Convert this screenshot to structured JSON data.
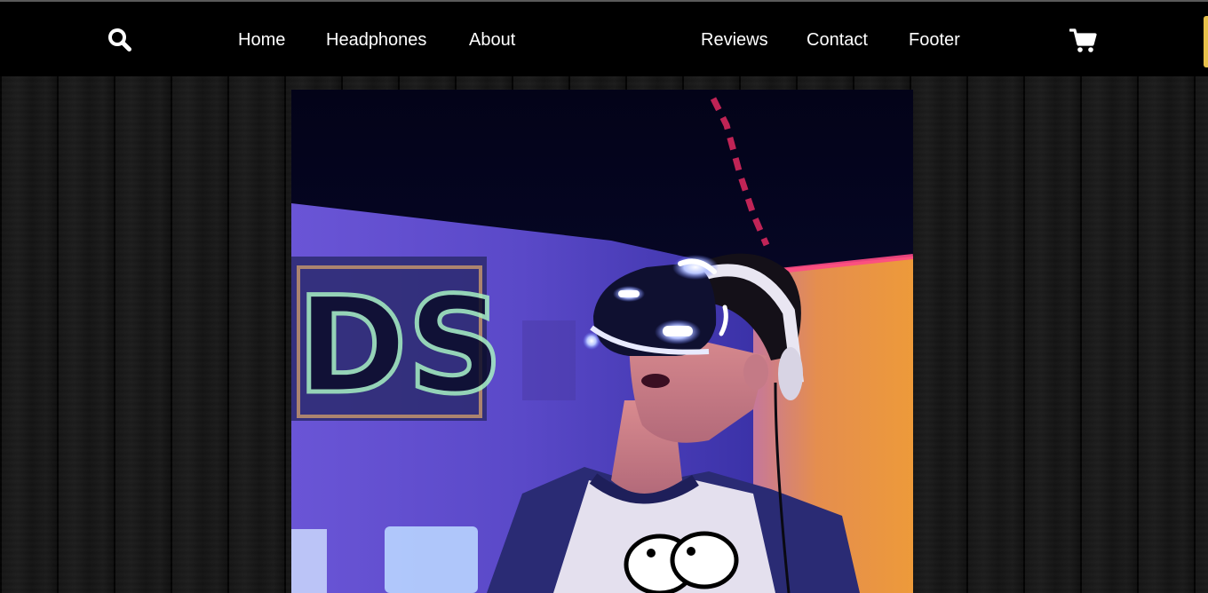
{
  "nav": {
    "links": [
      {
        "label": "Home"
      },
      {
        "label": "Headphones"
      },
      {
        "label": "About"
      },
      {
        "label": "Reviews"
      },
      {
        "label": "Contact"
      },
      {
        "label": "Footer"
      }
    ],
    "search_icon": "search-icon",
    "cart_icon": "shopping-cart-icon"
  },
  "hero": {
    "image": "photo of a person wearing a glowing VR headset in a neon-lit room",
    "sign_text": "DS"
  },
  "colors": {
    "navbar_bg": "#000000",
    "nav_text": "#ffffff",
    "scroll_accent": "#e6c04a",
    "neon_blue": "#9fb4ff"
  }
}
